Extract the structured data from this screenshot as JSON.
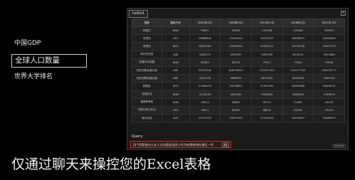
{
  "menu": {
    "items": [
      {
        "label": "中国GDP",
        "active": false
      },
      {
        "label": "全球人口数量",
        "active": true
      },
      {
        "label": "世界大学排名",
        "active": false
      }
    ]
  },
  "panel": {
    "tab_label": "table1",
    "table": {
      "headers": [
        "国家",
        "国家代码",
        "2001年人口",
        "2006年人口",
        "2011年人口",
        "2016年人口",
        "2021年人口"
      ],
      "rows": [
        [
          "阿鲁巴",
          "ABW",
          "90691",
          "95650",
          "101288",
          "103464",
          "106537"
        ],
        [
          "安哥拉",
          "AFG",
          "19688632",
          "25442944",
          "29249157",
          "34636207",
          "40099462"
        ],
        [
          "安哥拉",
          "AGO",
          "16941587",
          "20562540",
          "24259111",
          "29154746",
          "34503774"
        ],
        [
          "阿尔巴尼亚",
          "ALB",
          "3060173",
          "2992547",
          "2905195",
          "2876101",
          "2811666"
        ],
        [
          "安道尔共和国",
          "AND",
          "67820",
          "80221",
          "79917",
          "72540",
          "79034"
        ],
        [
          "阿拉伯联合酋长国",
          "ARE",
          "29351245",
          "328709957",
          "372531903",
          "415077905",
          "456520777"
        ],
        [
          "阿拉伯联合酋长国",
          "ARE",
          "3454178",
          "4898974",
          "8575205",
          "8994263",
          "9365145"
        ],
        [
          "阿根廷",
          "ARG",
          "37480493",
          "39476851",
          "41261490",
          "43590368",
          "45808747"
        ],
        [
          "亚美尼亚",
          "ARM",
          "3133133",
          "3003450",
          "2928959",
          "2865835",
          "2790974"
        ],
        [
          "美属萨摩亚",
          "ASM",
          "58324",
          "56837",
          "56710",
          "55465",
          "45035"
        ],
        [
          "安提瓜和巴布达",
          "ATG",
          "78471",
          "83991",
          "88275",
          "95544",
          "93219"
        ],
        [
          "澳大利亚",
          "AUS",
          "19274701",
          "20697900",
          "22340024",
          "24190907",
          "25688079"
        ]
      ]
    },
    "query": {
      "label": "Query",
      "text": "用个国家统计九年人口均值首选多少作为结果新增在最后一列",
      "submit_label": "Submit"
    }
  },
  "caption": "仅通过聊天来操控您的Excel表格",
  "colors": {
    "background": "#000000",
    "query_border": "#e02020"
  }
}
